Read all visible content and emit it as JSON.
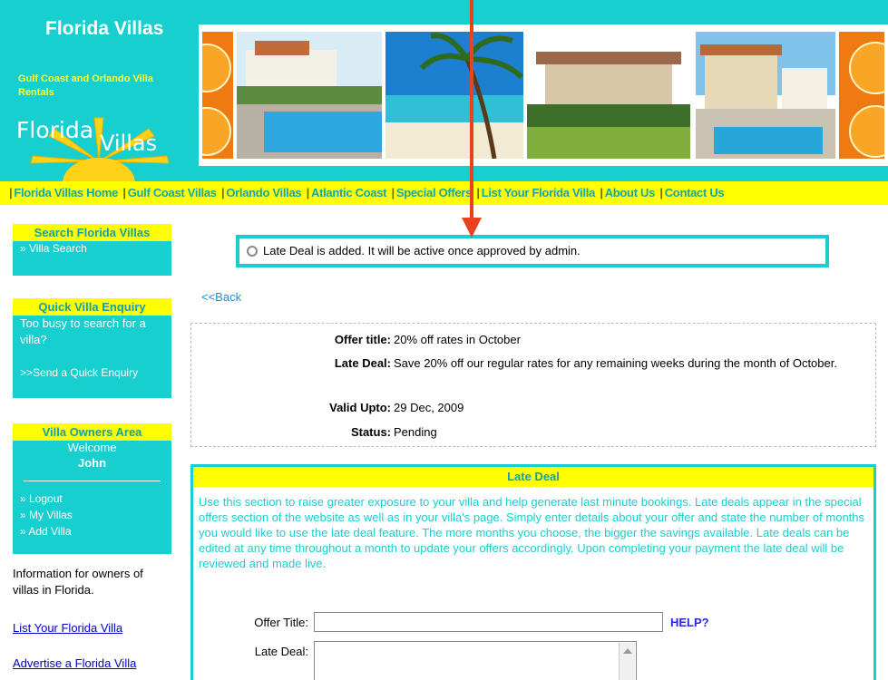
{
  "header": {
    "title": "Florida Villas",
    "subtitle": "Gulf Coast and Orlando Villa Rentals",
    "logo_word1": "Florida",
    "logo_word2": "Villas"
  },
  "nav": {
    "items": [
      "Florida Villas Home",
      "Gulf Coast Villas",
      "Orlando Villas",
      "Atlantic Coast",
      "Special Offers",
      "List Your Florida Villa",
      "About Us",
      "Contact Us"
    ],
    "separator": "|"
  },
  "sidebar": {
    "search": {
      "heading": "Search Florida Villas",
      "link": "» Villa Search"
    },
    "enquiry": {
      "heading": "Quick Villa Enquiry",
      "text": "Too busy to search for a villa?",
      "link": ">>Send a Quick Enquiry"
    },
    "owners": {
      "heading": "Villa Owners Area",
      "welcome": "Welcome",
      "user": "John",
      "links": [
        "» Logout",
        "» My Villas",
        "» Add Villa"
      ]
    },
    "info": "Information for owners of villas in Florida.",
    "list_link": "List Your Florida Villa",
    "advertise_link": "Advertise a Florida Villa"
  },
  "message": "Late Deal is added. It will be active once approved by admin.",
  "back": "<<Back",
  "offer": {
    "title_label": "Offer title:",
    "title_value": "20% off rates in October",
    "deal_label": "Late Deal:",
    "deal_value": "Save 20% off our regular rates for any remaining weeks during the month of October.",
    "valid_label": "Valid Upto:",
    "valid_value": "29 Dec, 2009",
    "status_label": "Status:",
    "status_value": "Pending"
  },
  "late_deal": {
    "heading": "Late Deal",
    "description": "Use this section to raise greater exposure to your villa and help generate last minute bookings. Late deals appear in the special offers section of the website as well as in your villa's page. Simply enter details about your offer and state the number of months you would like to use the late deal feature. The more months you choose, the bigger the savings available. Late deals can be edited at any time throughout a month to update your offers accordingly. Upon completing your payment the late deal will be reviewed and made live.",
    "offer_title_label": "Offer Title:",
    "offer_title_value": "",
    "help": "HELP?",
    "late_deal_label": "Late Deal:",
    "late_deal_value": ""
  },
  "colors": {
    "teal": "#17cfcf",
    "yellow": "#ffff00",
    "arrow": "#e8431c"
  }
}
